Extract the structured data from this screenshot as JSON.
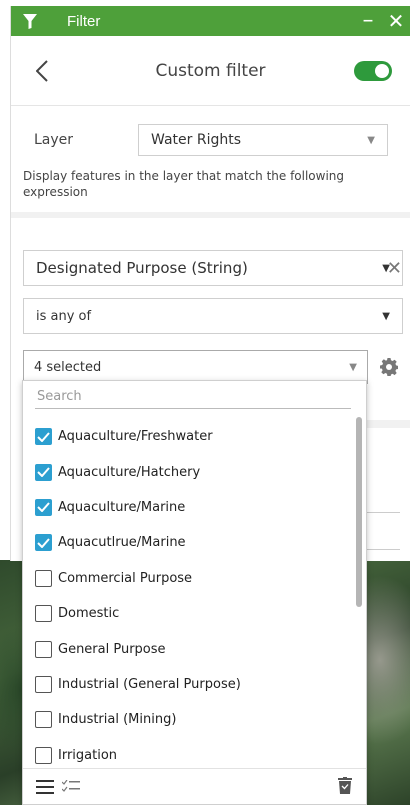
{
  "window": {
    "title": "Filter"
  },
  "header": {
    "title": "Custom filter",
    "toggle_on": true
  },
  "layer": {
    "label": "Layer",
    "value": "Water Rights"
  },
  "description": "Display features in the layer that match the following expression",
  "expression": {
    "field": "Designated Purpose (String)",
    "operator": "is any of",
    "values_summary": "4 selected"
  },
  "dropdown": {
    "search_placeholder": "Search",
    "items": [
      {
        "label": "Aquaculture/Freshwater",
        "checked": true
      },
      {
        "label": "Aquaculture/Hatchery",
        "checked": true
      },
      {
        "label": "Aquaculture/Marine",
        "checked": true
      },
      {
        "label": "Aquacutlrue/Marine",
        "checked": true
      },
      {
        "label": "Commercial Purpose",
        "checked": false
      },
      {
        "label": "Domestic",
        "checked": false
      },
      {
        "label": "General Purpose",
        "checked": false
      },
      {
        "label": "Industrial (General Purpose)",
        "checked": false
      },
      {
        "label": "Industrial (Mining)",
        "checked": false
      },
      {
        "label": "Irrigation",
        "checked": false
      }
    ]
  },
  "colors": {
    "titlebar": "#4ea03a",
    "toggle": "#2e9a3c",
    "checkbox": "#2c9fd0"
  }
}
